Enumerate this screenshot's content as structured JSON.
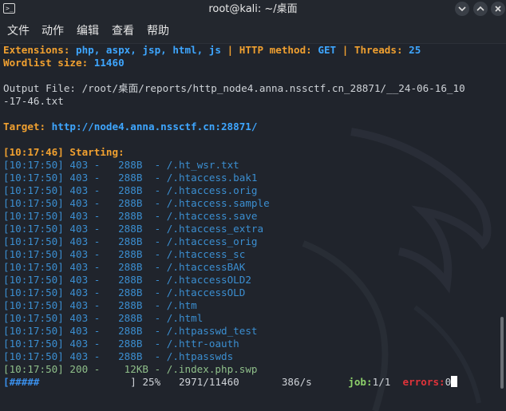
{
  "window": {
    "title": "root@kali: ~/桌面",
    "terminal_icon_glyph": ">_",
    "controls": [
      "minimize-icon",
      "maximize-icon",
      "close-icon"
    ]
  },
  "menu": {
    "file": "文件",
    "action": "动作",
    "edit": "编辑",
    "view": "查看",
    "help": "帮助"
  },
  "terminal": {
    "extensions_label": "Extensions:",
    "extensions_value": "php, aspx, jsp, html, js",
    "separator": "|",
    "http_method_label": "HTTP method:",
    "http_method_value": "GET",
    "threads_label": "Threads:",
    "threads_value": "25",
    "wordlist_label": "Wordlist size:",
    "wordlist_value": "11460",
    "output_line1": "Output File: /root/桌面/reports/http_node4.anna.nssctf.cn_28871/__24-06-16_10",
    "output_line2": "-17-46.txt",
    "target_label": "Target:",
    "target_value": "http://node4.anna.nssctf.cn:28871/",
    "starting_time": "[10:17:46]",
    "starting_label": "Starting:",
    "results": [
      {
        "time": "[10:17:50]",
        "status": "403",
        "size": "288B",
        "path": "/.ht_wsr.txt"
      },
      {
        "time": "[10:17:50]",
        "status": "403",
        "size": "288B",
        "path": "/.htaccess.bak1"
      },
      {
        "time": "[10:17:50]",
        "status": "403",
        "size": "288B",
        "path": "/.htaccess.orig"
      },
      {
        "time": "[10:17:50]",
        "status": "403",
        "size": "288B",
        "path": "/.htaccess.sample"
      },
      {
        "time": "[10:17:50]",
        "status": "403",
        "size": "288B",
        "path": "/.htaccess.save"
      },
      {
        "time": "[10:17:50]",
        "status": "403",
        "size": "288B",
        "path": "/.htaccess_extra"
      },
      {
        "time": "[10:17:50]",
        "status": "403",
        "size": "288B",
        "path": "/.htaccess_orig"
      },
      {
        "time": "[10:17:50]",
        "status": "403",
        "size": "288B",
        "path": "/.htaccess_sc"
      },
      {
        "time": "[10:17:50]",
        "status": "403",
        "size": "288B",
        "path": "/.htaccessBAK"
      },
      {
        "time": "[10:17:50]",
        "status": "403",
        "size": "288B",
        "path": "/.htaccessOLD2"
      },
      {
        "time": "[10:17:50]",
        "status": "403",
        "size": "288B",
        "path": "/.htaccessOLD"
      },
      {
        "time": "[10:17:50]",
        "status": "403",
        "size": "288B",
        "path": "/.htm"
      },
      {
        "time": "[10:17:50]",
        "status": "403",
        "size": "288B",
        "path": "/.html"
      },
      {
        "time": "[10:17:50]",
        "status": "403",
        "size": "288B",
        "path": "/.htpasswd_test"
      },
      {
        "time": "[10:17:50]",
        "status": "403",
        "size": "288B",
        "path": "/.httr-oauth"
      },
      {
        "time": "[10:17:50]",
        "status": "403",
        "size": "288B",
        "path": "/.htpasswds"
      }
    ],
    "found": {
      "time": "[10:17:50]",
      "status": "200",
      "size": "12KB",
      "path": "/.index.php.swp"
    },
    "progress": {
      "bar_open": "[",
      "bar_fill": "#####",
      "bar_close": "]",
      "percent": "25%",
      "count": "2971/11460",
      "rate": "386/s",
      "job_label": "job:",
      "job_value": "1/1",
      "errors_label": "errors:",
      "errors_value": "0"
    }
  },
  "colors": {
    "orange": "#f0a030",
    "blue": "#3ea6ff",
    "result_blue": "#3b8ed0",
    "found_green": "#8fbf8a",
    "errors_red": "#e0333a"
  }
}
